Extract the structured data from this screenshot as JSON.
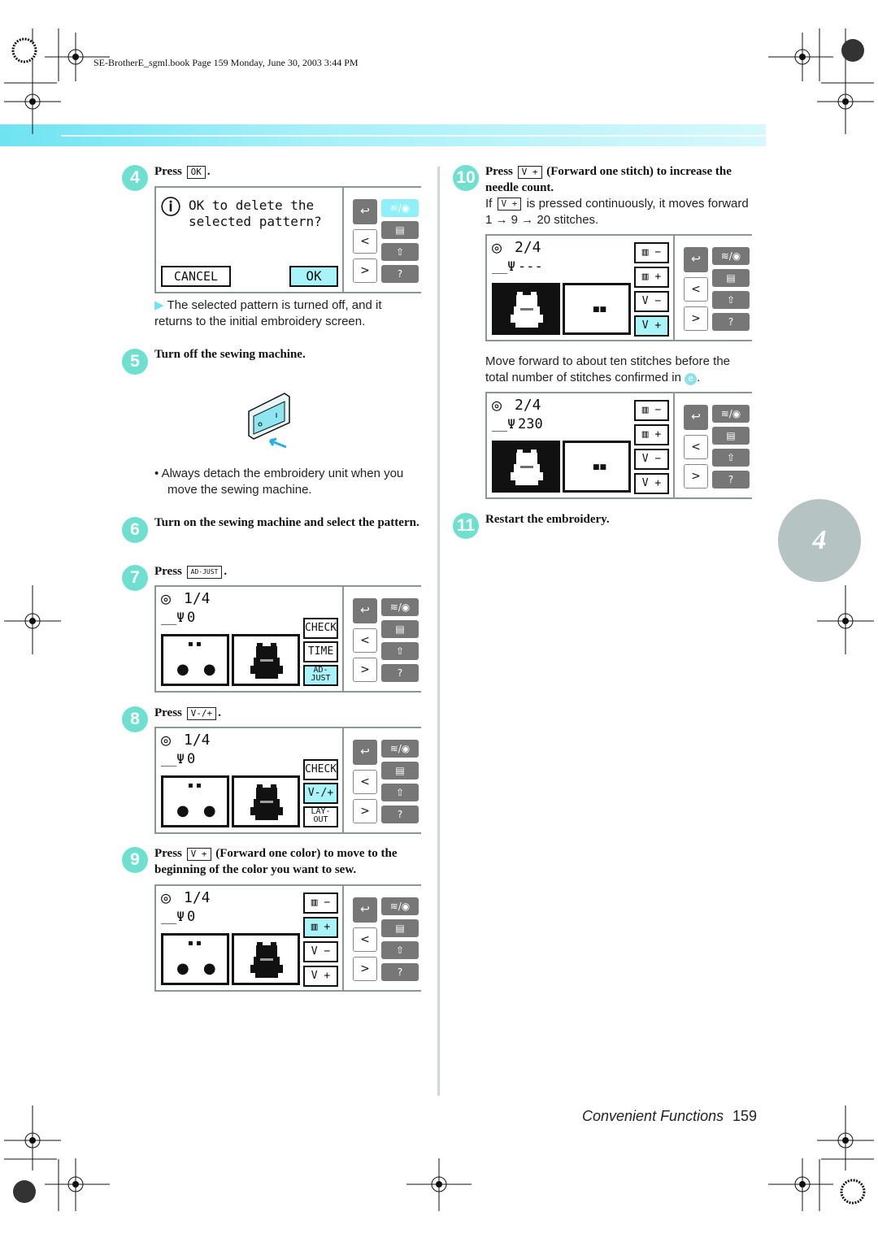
{
  "header": {
    "text": "SE-BrotherE_sgml.book  Page 159  Monday, June 30, 2003  3:44 PM"
  },
  "colors": {
    "accent": "#6fe0cf",
    "band": "#8fe9f5",
    "active_button": "#a8f4f8",
    "side_button": "#777777"
  },
  "steps": {
    "s4": {
      "num": "4",
      "press": "Press",
      "key": "OK",
      "after": ".",
      "result": "The selected pattern is turned off, and it returns to the initial embroidery screen."
    },
    "s5": {
      "num": "5",
      "title": "Turn off the sewing machine.",
      "bullet": "Always detach the embroidery unit when you move the sewing machine."
    },
    "s6": {
      "num": "6",
      "title": "Turn on the sewing machine and select the pattern."
    },
    "s7": {
      "num": "7",
      "press": "Press",
      "key": "AD-JUST",
      "after": "."
    },
    "s8": {
      "num": "8",
      "press": "Press",
      "key": "V-/+",
      "after": "."
    },
    "s9": {
      "num": "9",
      "press": "Press",
      "key": "V +",
      "title": "(Forward one color) to move to the beginning of the color you want to sew."
    },
    "s10": {
      "num": "10",
      "press": "Press",
      "key": "V +",
      "title": "(Forward one stitch) to increase the needle count.",
      "note_if": "If",
      "note_key": "V +",
      "note_rest": "is pressed continuously, it moves forward 1 → 9 → 20 stitches.",
      "text2": "Move forward to about ten stitches before the total number of stitches confirmed in",
      "text2_ref": "e",
      "text2_end": "."
    },
    "s11": {
      "num": "11",
      "title": "Restart the embroidery."
    }
  },
  "panels": {
    "p4": {
      "type": "dialog",
      "line1": "OK to delete the",
      "line2": "selected pattern?",
      "cancel": "CANCEL",
      "ok": "OK"
    },
    "p7": {
      "type": "emb",
      "counter": "1/4",
      "stitch": "0",
      "buttons": [
        {
          "label": "CHECK"
        },
        {
          "label": "TIME"
        },
        {
          "label": "AD-\nJUST",
          "active": true
        }
      ]
    },
    "p8": {
      "type": "emb",
      "counter": "1/4",
      "stitch": "0",
      "buttons": [
        {
          "label": "CHECK"
        },
        {
          "label": "V-/+",
          "active": true
        },
        {
          "label": "LAY-\nOUT"
        }
      ]
    },
    "p9": {
      "type": "emb2",
      "counter": "1/4",
      "stitch": "0",
      "buttons": [
        {
          "label": "▥ −"
        },
        {
          "label": "▥ +",
          "active": true
        },
        {
          "label": "V −"
        },
        {
          "label": "V +"
        }
      ]
    },
    "p10a": {
      "type": "emb3",
      "counter": "2/4",
      "stitch": "---",
      "buttons": [
        {
          "label": "▥ −"
        },
        {
          "label": "▥ +"
        },
        {
          "label": "V −"
        },
        {
          "label": "V +",
          "active": true
        }
      ]
    },
    "p10b": {
      "type": "emb3",
      "counter": "2/4",
      "stitch": "230",
      "buttons": [
        {
          "label": "▥ −"
        },
        {
          "label": "▥ +"
        },
        {
          "label": "V −"
        },
        {
          "label": "V +"
        }
      ]
    }
  },
  "side_buttons": {
    "back": "↩",
    "prev": "<",
    "next": ">",
    "icons": [
      "embroidery-edit-icon",
      "list-icon",
      "frame-move-icon",
      "help-icon"
    ]
  },
  "footer": {
    "section": "Convenient Functions",
    "page": "159"
  },
  "chapter_tab": "4"
}
